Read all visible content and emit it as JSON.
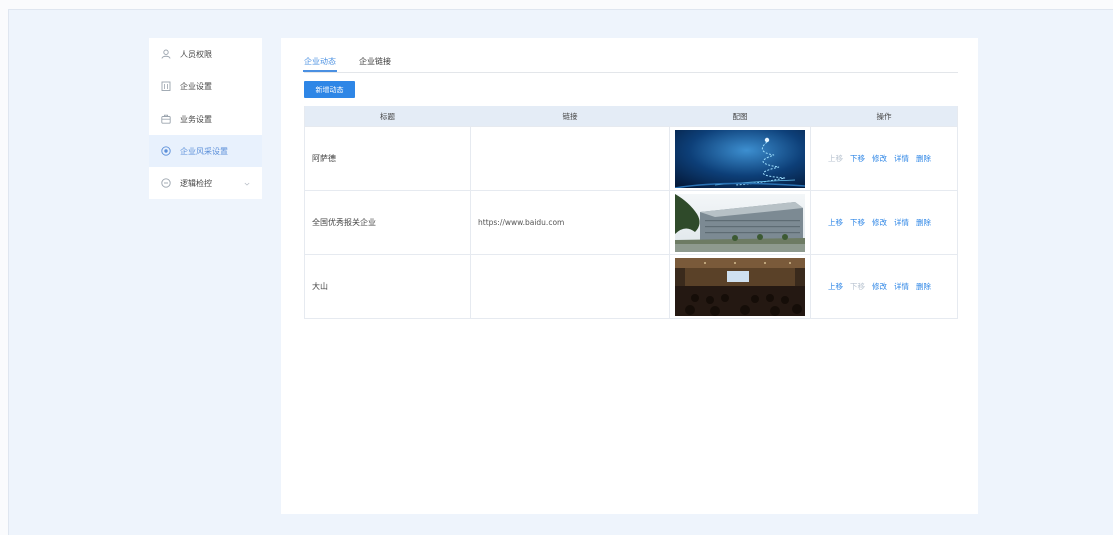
{
  "sidebar": {
    "items": [
      {
        "label": "人员权限",
        "icon": "user-icon",
        "active": false
      },
      {
        "label": "企业设置",
        "icon": "building-icon",
        "active": false
      },
      {
        "label": "业务设置",
        "icon": "briefcase-icon",
        "active": false
      },
      {
        "label": "企业风采设置",
        "icon": "target-icon",
        "active": true
      },
      {
        "label": "逻辑检控",
        "icon": "minus-circle-icon",
        "active": false,
        "expandable": true
      }
    ]
  },
  "tabs": [
    {
      "label": "企业动态",
      "active": true
    },
    {
      "label": "企业链接",
      "active": false
    }
  ],
  "toolbar": {
    "add_label": "新增动态"
  },
  "table": {
    "headers": [
      "标题",
      "链接",
      "配图",
      "操作"
    ],
    "rows": [
      {
        "title": "阿萨德",
        "link": "",
        "image": "christmas-tree-light-image",
        "ops": {
          "up": "上移",
          "down": "下移",
          "edit": "修改",
          "detail": "详情",
          "delete": "删除"
        },
        "up_disabled": true,
        "down_disabled": false
      },
      {
        "title": "全国优秀报关企业",
        "link": "https://www.baidu.com",
        "image": "office-building-image",
        "ops": {
          "up": "上移",
          "down": "下移",
          "edit": "修改",
          "detail": "详情",
          "delete": "删除"
        },
        "up_disabled": false,
        "down_disabled": false
      },
      {
        "title": "大山",
        "link": "",
        "image": "conference-hall-image",
        "ops": {
          "up": "上移",
          "down": "下移",
          "edit": "修改",
          "detail": "详情",
          "delete": "删除"
        },
        "up_disabled": false,
        "down_disabled": true
      }
    ]
  },
  "colors": {
    "accent": "#2e86e6",
    "active_bg": "#e8f1fd",
    "header_bg": "#e4ecf6",
    "page_bg": "#eef4fc"
  }
}
